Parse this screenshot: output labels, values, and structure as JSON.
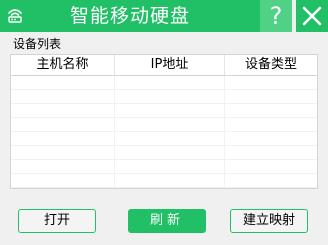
{
  "window": {
    "title": "智能移动硬盘",
    "help_glyph": "?",
    "accent_color": "#21c066"
  },
  "list": {
    "group_label": "设备列表",
    "columns": [
      "主机名称",
      "IP地址",
      "设备类型"
    ],
    "rows": []
  },
  "buttons": {
    "open_label": "打开",
    "refresh_label": "刷新",
    "map_label": "建立映射"
  },
  "icons": {
    "app": "wifi-router-icon",
    "help": "help-icon",
    "close": "close-icon"
  }
}
